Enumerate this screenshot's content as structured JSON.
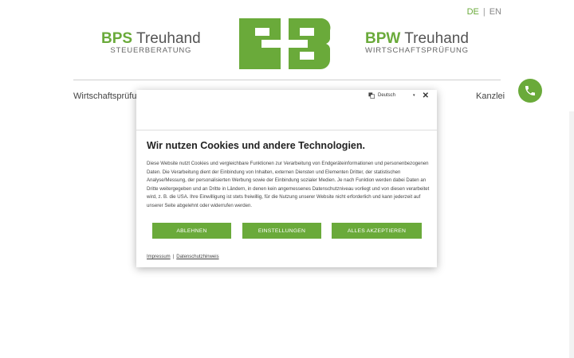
{
  "header": {
    "lang_de": "DE",
    "lang_sep": "|",
    "lang_en": "EN",
    "left_brand": {
      "strong": "BPS",
      "rest": " Treuhand",
      "sub": "STEUERBERATUNG"
    },
    "right_brand": {
      "strong": "BPW",
      "rest": " Treuhand",
      "sub": "WIRTSCHAFTSPRÜFUNG"
    },
    "brand_color": "#6aaa3a"
  },
  "nav": {
    "left": "Wirtschaftsprüfung",
    "right": "Kanzlei"
  },
  "cookie_modal": {
    "language": "Deutsch",
    "title": "Wir nutzen Cookies und andere Technologien.",
    "body": "Diese Website nutzt Cookies und vergleichbare Funktionen zur Verarbeitung von Endgeräteinformationen und personenbezogenen Daten. Die Verarbeitung dient der Einbindung von Inhalten, externen Diensten und Elementen Dritter, der statistischen Analyse/Messung, der personalisierten Werbung sowie der Einbindung sozialer Medien. Je nach Funktion werden dabei Daten an Dritte weitergegeben und an Dritte in Ländern, in denen kein angemessenes Datenschutzniveau vorliegt und von diesen verarbeitet wird, z. B. die USA. Ihre Einwilligung ist stets freiwillig, für die Nutzung unserer Website nicht erforderlich und kann jederzeit auf unserer Seite abgelehnt oder widerrufen werden.",
    "buttons": {
      "reject": "ABLEHNEN",
      "settings": "EINSTELLUNGEN",
      "accept_all": "ALLES AKZEPTIEREN"
    },
    "links": {
      "imprint": "Impressum",
      "sep": "|",
      "privacy": "Datenschutzhinweis"
    }
  }
}
